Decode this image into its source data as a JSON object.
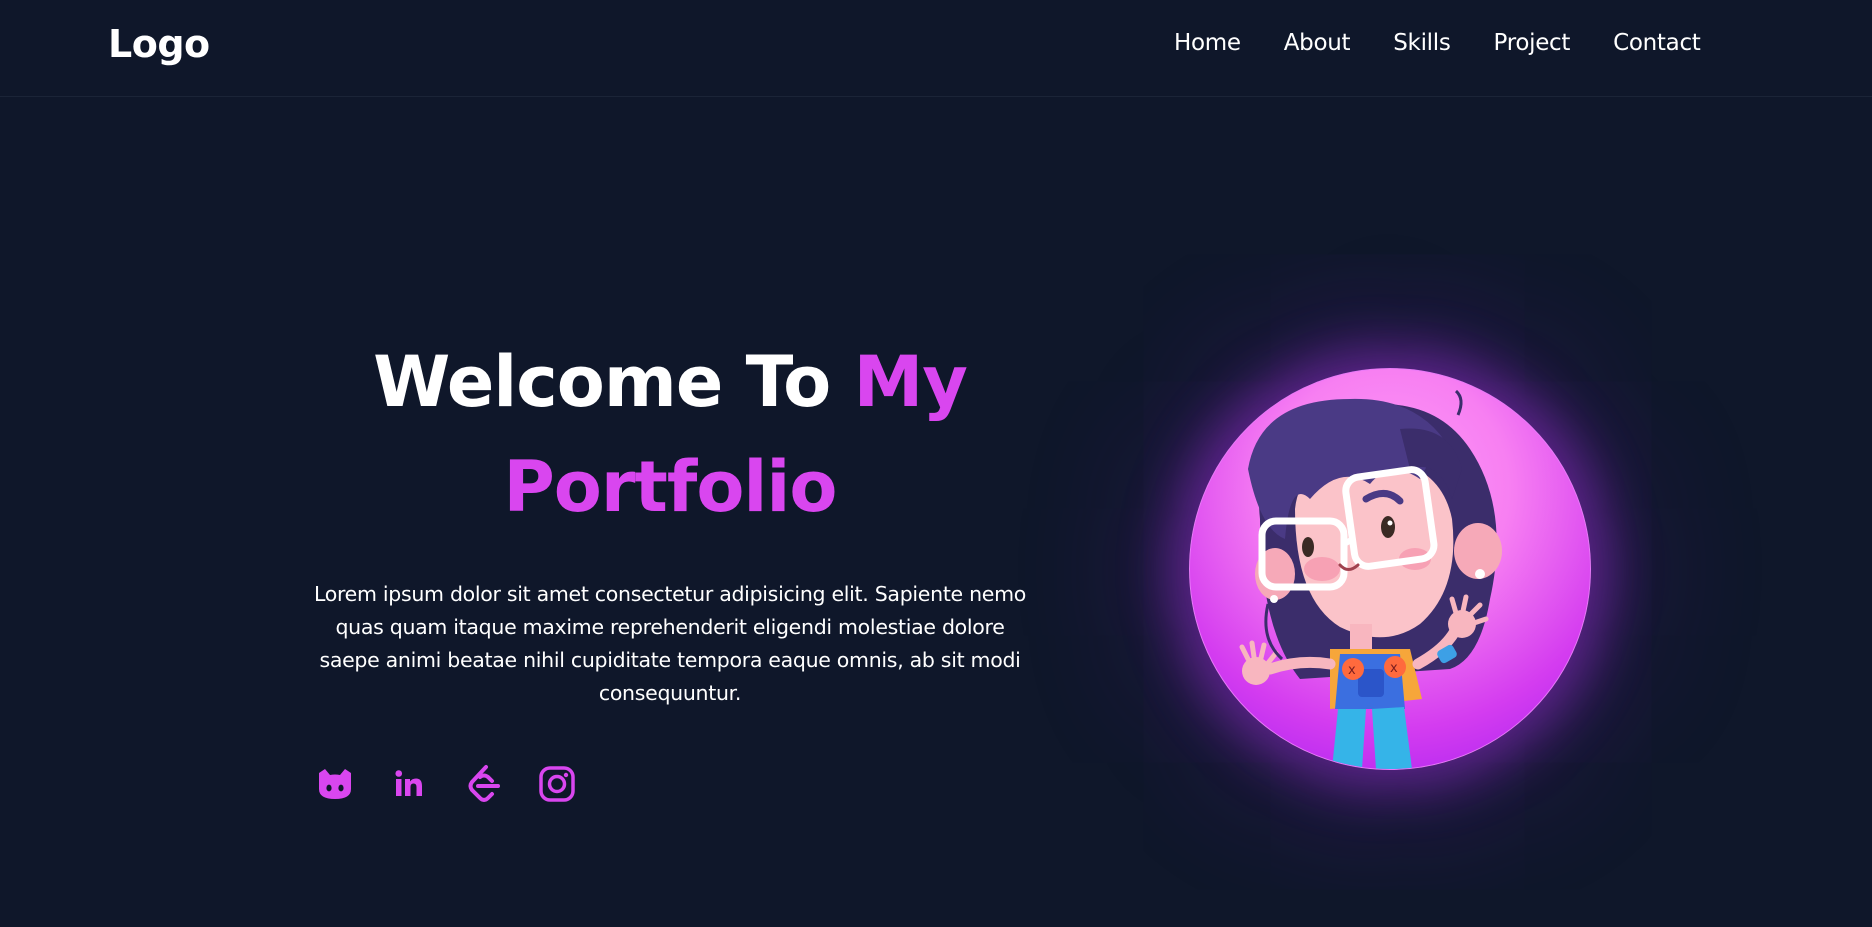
{
  "navbar": {
    "logo": "Logo",
    "links": [
      "Home",
      "About",
      "Skills",
      "Project",
      "Contact"
    ]
  },
  "hero": {
    "title_part1": "Welcome To ",
    "title_accent1": "My",
    "title_accent2": "Portfolio",
    "description": "Lorem ipsum dolor sit amet consectetur adipisicing elit. Sapiente nemo quas quam itaque maxime reprehenderit eligendi molestiae dolore saepe animi beatae nihil cupiditate tempora eaque omnis, ab sit modi consequuntur."
  },
  "socials": [
    {
      "icon": "github-icon"
    },
    {
      "icon": "linkedin-icon"
    },
    {
      "icon": "leetcode-icon"
    },
    {
      "icon": "instagram-icon"
    }
  ],
  "colors": {
    "background": "#0f172a",
    "accent": "#d946ef",
    "text": "#ffffff"
  }
}
